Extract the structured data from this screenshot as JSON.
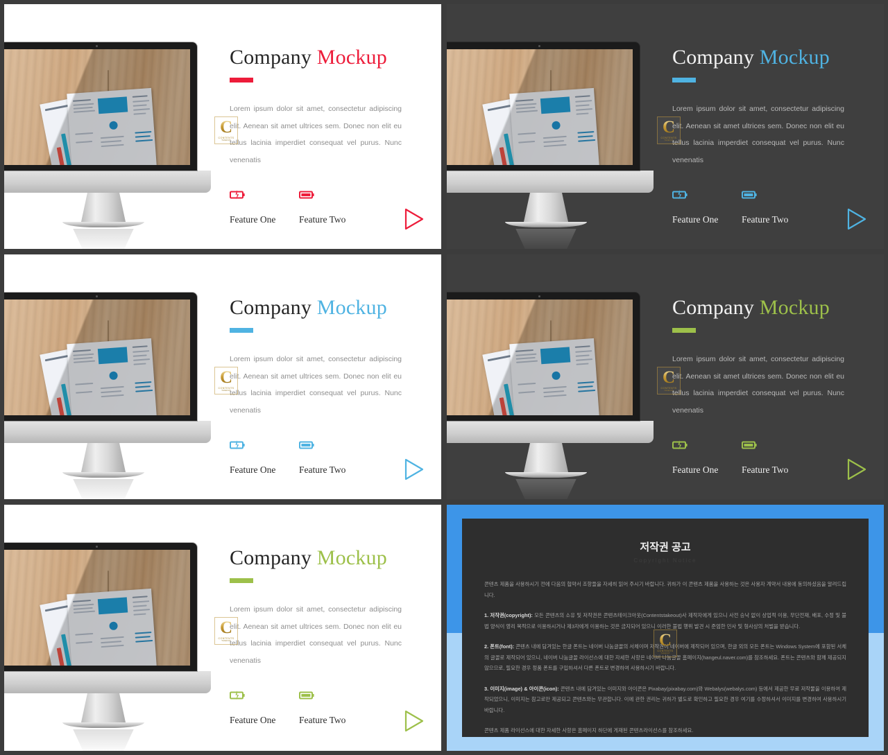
{
  "meta": {
    "layout": "2x3 grid of presentation slide thumbnails",
    "body_text": "Lorem ipsum dolor sit amet, consectetur adipiscing elit. Aenean sit amet ultrices sem. Donec non elit eu tellus lacinia imperdiet consequat vel purus. Nunc venenatis",
    "title_word_1": "Company",
    "title_word_2": "Mockup",
    "feature_one": "Feature One",
    "feature_two": "Feature Two",
    "icon_feature_one": "battery-charging-icon",
    "icon_feature_two": "battery-full-icon",
    "icon_play": "play-triangle-icon",
    "icon_monitor": "imac-monitor-mockup",
    "watermark": {
      "letter": "C",
      "line1": "CONTENTS",
      "line2": "TAKEOUT"
    }
  },
  "colors": {
    "red": "#ED1C3A",
    "blue": "#4FB3E2",
    "green": "#9DC04A",
    "dark_panel": "#3f3f3f",
    "light_panel": "#ffffff",
    "page_background": "#3c3c3c",
    "frame_blue_top": "#3D95E8",
    "frame_blue_bottom": "#A9D4F8",
    "card_background": "#2e2e2e"
  },
  "panels": [
    {
      "id": "top-left",
      "theme": "light",
      "accent": "#ED1C3A",
      "accent_name": "red"
    },
    {
      "id": "top-right",
      "theme": "dark",
      "accent": "#4FB3E2",
      "accent_name": "blue"
    },
    {
      "id": "middle-left",
      "theme": "light",
      "accent": "#4FB3E2",
      "accent_name": "blue"
    },
    {
      "id": "middle-right",
      "theme": "dark",
      "accent": "#9DC04A",
      "accent_name": "green"
    },
    {
      "id": "bottom-left",
      "theme": "light",
      "accent": "#9DC04A",
      "accent_name": "green"
    }
  ],
  "copyright_panel": {
    "title": "저작권 공고",
    "subtitle": "Copyright Notice",
    "paragraphs": [
      "콘텐츠 제품을 사용하시기 전에 다음의 협약서 조항들을 자세히 읽어 주시기 바랍니다. 귀하가 이 콘텐츠 제품을 사용하는 것은 사용자 계약서 내용에 동의하셨음을 알려드립니다.",
      "<b>1. 저작권(copyright):</b> 모든 콘텐츠의 소유 및 저작권은 콘텐츠테이크아웃(Contentstakeout)사 제작자에게 있으니 사전 승낙 없이 상업적 이용, 무단전재, 배포, 수정 및 불법 양식이 영리 목적으로 이용하시거나 제3자에게 이용하는 것은 금지되어 있으니 이러한 불법 행위 발견 시 준엄한 민사 및 형사상의 처벌을 받습니다.",
      "<b>2. 폰트(font):</b> 콘텐츠 내에 담겨있는 한글 폰트는 네이버 나눔글꼴의 서체이며 저작권이 네이버에 제작되어 있으며, 한글 외의 모든 폰트는 Windows System에 포함된 서체의 글꼴로 제작되어 있으니, 네이버 나눔글꼴 라이선스에 대한 자세한 사항은 네이버 나눔글꼴 홈페이지(hangeul.naver.com)를 참조하세요. 폰트는 콘텐츠와 함께 제공되지 않으므로, 필요한 경우 정품 폰트를 구입하셔서 다른 폰트로 변경하여 사용하시기 바랍니다.",
      "<b>3. 이미지(image) &amp; 아이콘(icon):</b> 콘텐츠 내에 담겨있는 이미지와 아이콘은 Pixabay(pixabay.com)와 Webalys(webalys.com) 등에서 제공한 무료 저작물을 이용하여 제작되었으니, 이미지는 참고로만 제공되고 콘텐츠와는 무관합니다. 이에 관한 권리는 귀하가 별도로 확인하고 필요한 경우 여기를 수정하셔서 이미지를 변경하여 사용하시기 바랍니다.",
      "콘텐츠 제품 라이선스에 대한 자세한 사항은 홈페이지 하단에 게재된 콘텐츠라이선스를 참조하세요."
    ]
  }
}
